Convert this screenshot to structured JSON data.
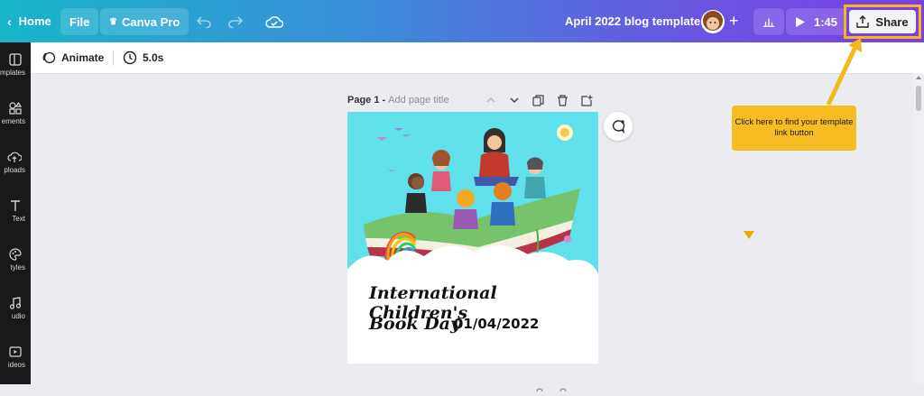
{
  "topbar": {
    "home_label": "Home",
    "file_label": "File",
    "canva_pro_label": "Canva Pro",
    "doc_title": "April 2022 blog templates",
    "timer_label": "1:45",
    "share_label": "Share",
    "add_label": "+"
  },
  "sidebar": {
    "items": [
      {
        "label": "emplates"
      },
      {
        "label": "ements"
      },
      {
        "label": "ploads"
      },
      {
        "label": "Text"
      },
      {
        "label": "tyles"
      },
      {
        "label": "udio"
      },
      {
        "label": "ideos"
      }
    ]
  },
  "toolbar2": {
    "animate_label": "Animate",
    "duration_label": "5.0s"
  },
  "page": {
    "page_number_label": "Page 1 -",
    "title_placeholder": "Add page title"
  },
  "design": {
    "line1": "International Children's",
    "line2": "Book Day",
    "date": "01/04/2022"
  },
  "callout": {
    "text": "Click here to find your template link button"
  },
  "colors": {
    "accent": "#f7bc22",
    "canvas_bg": "#5fe0ea"
  }
}
